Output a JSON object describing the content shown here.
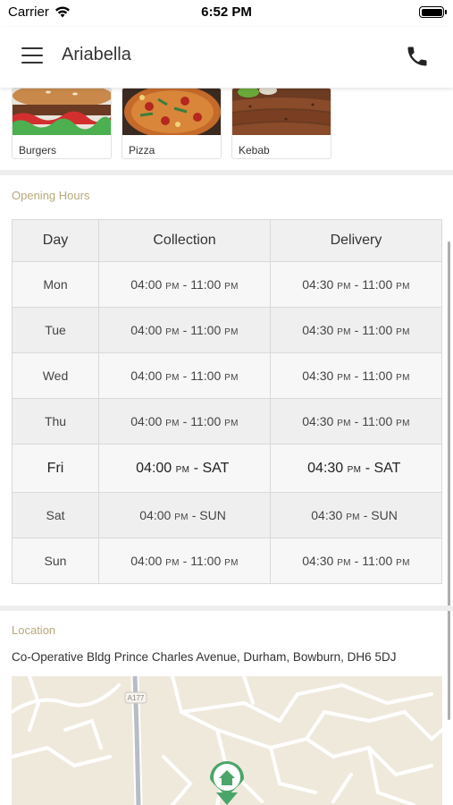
{
  "status_bar": {
    "carrier": "Carrier",
    "time": "6:52 PM"
  },
  "nav": {
    "title": "Ariabella",
    "menu_icon": "hamburger-menu-icon",
    "call_icon": "phone-icon"
  },
  "categories": [
    {
      "label": "Burgers"
    },
    {
      "label": "Pizza"
    },
    {
      "label": "Kebab"
    }
  ],
  "opening_hours": {
    "label": "Opening Hours",
    "headers": [
      "Day",
      "Collection",
      "Delivery"
    ],
    "rows": [
      {
        "day": "Mon",
        "collection": {
          "start": "04:00",
          "start_suffix": "PM",
          "sep": " - ",
          "end": "11:00",
          "end_suffix": "PM"
        },
        "delivery": {
          "start": "04:30",
          "start_suffix": "PM",
          "sep": " - ",
          "end": "11:00",
          "end_suffix": "PM"
        }
      },
      {
        "day": "Tue",
        "collection": {
          "start": "04:00",
          "start_suffix": "PM",
          "sep": " - ",
          "end": "11:00",
          "end_suffix": "PM"
        },
        "delivery": {
          "start": "04:30",
          "start_suffix": "PM",
          "sep": " - ",
          "end": "11:00",
          "end_suffix": "PM"
        }
      },
      {
        "day": "Wed",
        "collection": {
          "start": "04:00",
          "start_suffix": "PM",
          "sep": " - ",
          "end": "11:00",
          "end_suffix": "PM"
        },
        "delivery": {
          "start": "04:30",
          "start_suffix": "PM",
          "sep": " - ",
          "end": "11:00",
          "end_suffix": "PM"
        }
      },
      {
        "day": "Thu",
        "collection": {
          "start": "04:00",
          "start_suffix": "PM",
          "sep": " - ",
          "end": "11:00",
          "end_suffix": "PM"
        },
        "delivery": {
          "start": "04:30",
          "start_suffix": "PM",
          "sep": " - ",
          "end": "11:00",
          "end_suffix": "PM"
        }
      },
      {
        "day": "Fri",
        "collection": {
          "start": "04:00",
          "start_suffix": "PM",
          "sep": " - ",
          "end": "SAT",
          "end_suffix": ""
        },
        "delivery": {
          "start": "04:30",
          "start_suffix": "PM",
          "sep": " - ",
          "end": "SAT",
          "end_suffix": ""
        }
      },
      {
        "day": "Sat",
        "collection": {
          "start": "04:00",
          "start_suffix": "PM",
          "sep": " - ",
          "end": "SUN",
          "end_suffix": ""
        },
        "delivery": {
          "start": "04:30",
          "start_suffix": "PM",
          "sep": " - ",
          "end": "SUN",
          "end_suffix": ""
        }
      },
      {
        "day": "Sun",
        "collection": {
          "start": "04:00",
          "start_suffix": "PM",
          "sep": " - ",
          "end": "11:00",
          "end_suffix": "PM"
        },
        "delivery": {
          "start": "04:30",
          "start_suffix": "PM",
          "sep": " - ",
          "end": "11:00",
          "end_suffix": "PM"
        }
      }
    ]
  },
  "location": {
    "label": "Location",
    "address": "Co-Operative Bldg Prince Charles Avenue, Durham, Bowburn, DH6 5DJ",
    "road_label": "A177",
    "marker_icon": "home-marker-icon"
  },
  "colors": {
    "section_label": "#b8a97a",
    "map_background": "#efe9dc",
    "marker": "#4ba56a"
  }
}
